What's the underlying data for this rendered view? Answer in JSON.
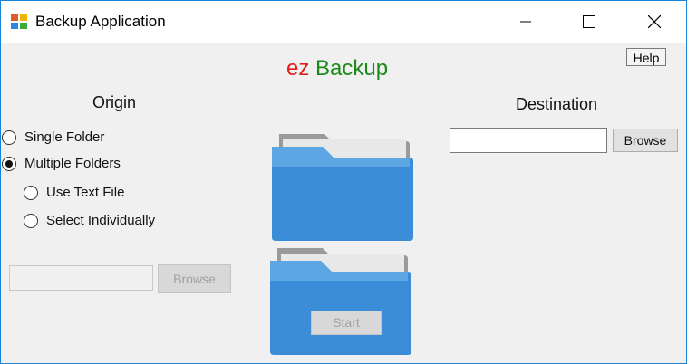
{
  "window": {
    "title": "Backup Application"
  },
  "brand": {
    "part1": "ez",
    "part2": "Backup"
  },
  "help": {
    "label": "Help"
  },
  "origin": {
    "heading": "Origin",
    "options": [
      {
        "label": "Single Folder",
        "checked": false
      },
      {
        "label": "Multiple Folders",
        "checked": true
      },
      {
        "label": "Use Text File",
        "checked": false
      },
      {
        "label": "Select Individually",
        "checked": false
      }
    ],
    "path_value": "",
    "browse_label": "Browse"
  },
  "destination": {
    "heading": "Destination",
    "path_value": "",
    "browse_label": "Browse"
  },
  "start": {
    "label": "Start"
  },
  "colors": {
    "accent": "#1883d7",
    "folder": "#3a8dd6",
    "brand_ez": "#e02020",
    "brand_backup": "#1a8a1a"
  }
}
